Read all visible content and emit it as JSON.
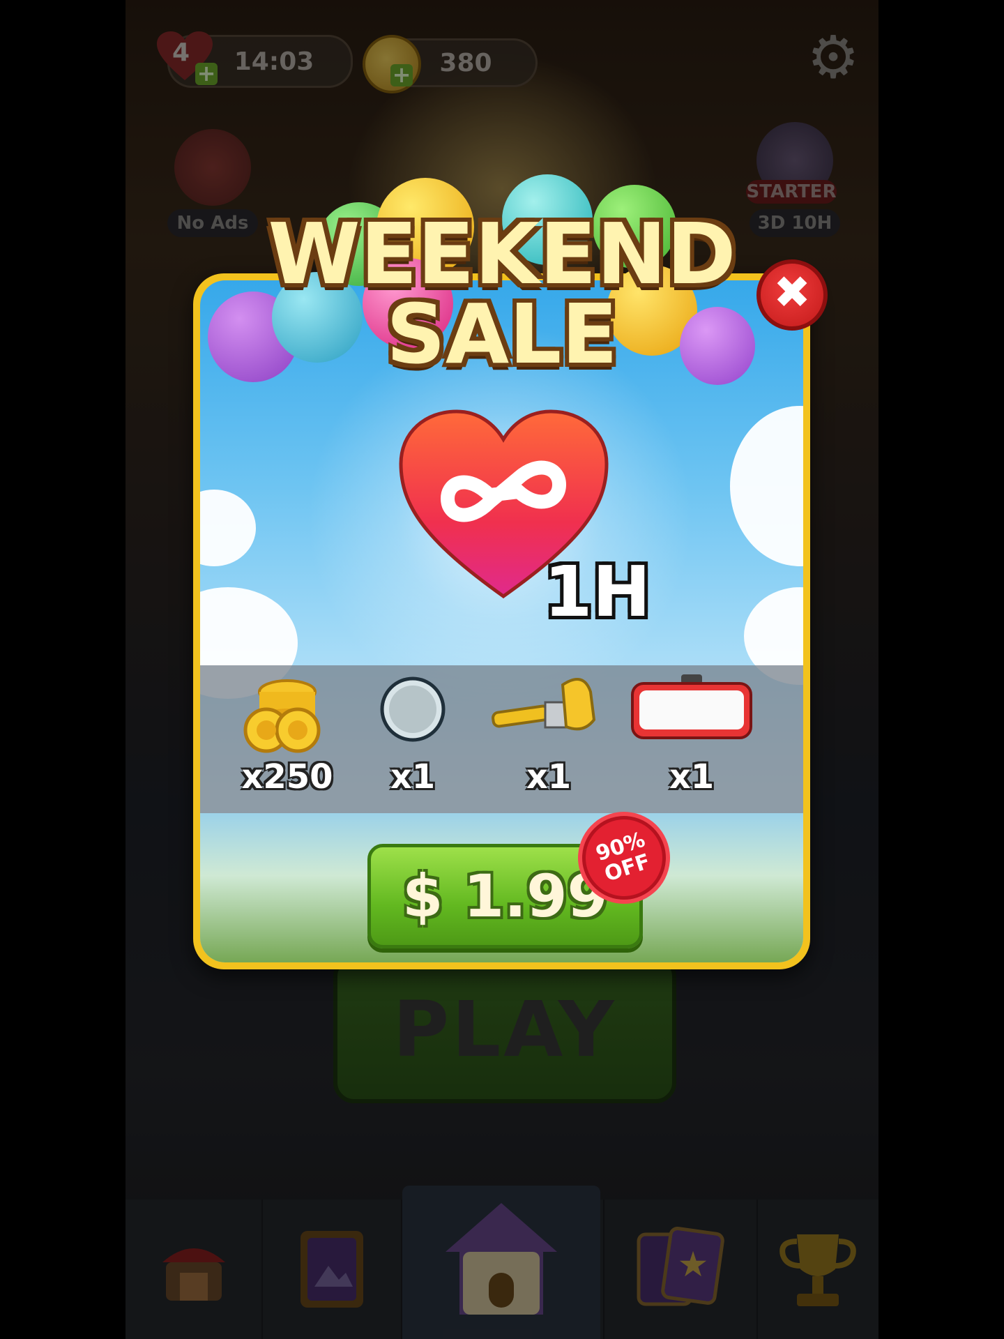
{
  "hud": {
    "lives_count": "4",
    "lives_timer": "14:03",
    "coins": "380"
  },
  "side_offers": {
    "no_ads_label": "No Ads",
    "starter_label": "STARTER",
    "starter_timer": "3D 10H"
  },
  "play_label": "PLAY",
  "popup": {
    "title_line1": "WEEKEND",
    "title_line2": "SALE",
    "duration": "1H",
    "items": [
      {
        "name": "coins",
        "qty": "x250"
      },
      {
        "name": "ring",
        "qty": "x1"
      },
      {
        "name": "hammer",
        "qty": "x1"
      },
      {
        "name": "toolbox",
        "qty": "x1"
      }
    ],
    "price": "$ 1.99",
    "discount_line1": "90%",
    "discount_line2": "OFF"
  },
  "colors": {
    "popup_frame": "#f2c21e",
    "price_button": "#62b820",
    "close_button": "#d42424",
    "badge": "#e32131"
  }
}
